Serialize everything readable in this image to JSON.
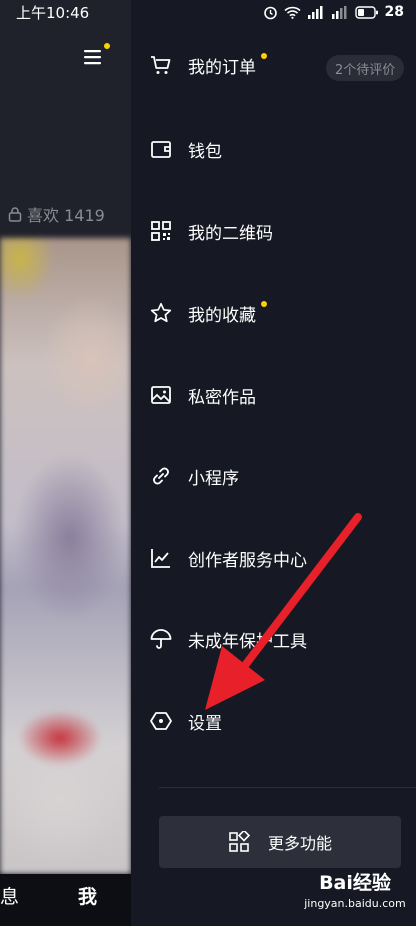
{
  "status_bar": {
    "time": "上午10:46",
    "battery": "28"
  },
  "profile_bg": {
    "likes_label": "喜欢 1419",
    "tabs": [
      "息",
      "我"
    ]
  },
  "drawer": {
    "pending_badge": "2个待评价",
    "items": [
      {
        "label": "我的订单",
        "icon": "cart-icon",
        "dot": true
      },
      {
        "label": "钱包",
        "icon": "wallet-icon",
        "dot": false
      },
      {
        "label": "我的二维码",
        "icon": "qr-code-icon",
        "dot": false
      },
      {
        "label": "我的收藏",
        "icon": "star-icon",
        "dot": true
      },
      {
        "label": "私密作品",
        "icon": "private-image-icon",
        "dot": false
      },
      {
        "label": "小程序",
        "icon": "link-icon",
        "dot": false
      },
      {
        "label": "创作者服务中心",
        "icon": "chart-icon",
        "dot": false
      },
      {
        "label": "未成年保护工具",
        "icon": "umbrella-icon",
        "dot": false
      },
      {
        "label": "设置",
        "icon": "hexagon-settings-icon",
        "dot": false
      }
    ],
    "more_button": "更多功能"
  },
  "watermark": {
    "brand": "Bai经验",
    "url": "jingyan.baidu.com"
  },
  "colors": {
    "background": "#161823",
    "accent_dot": "#fcd100",
    "annotation_arrow": "#e8202a"
  }
}
